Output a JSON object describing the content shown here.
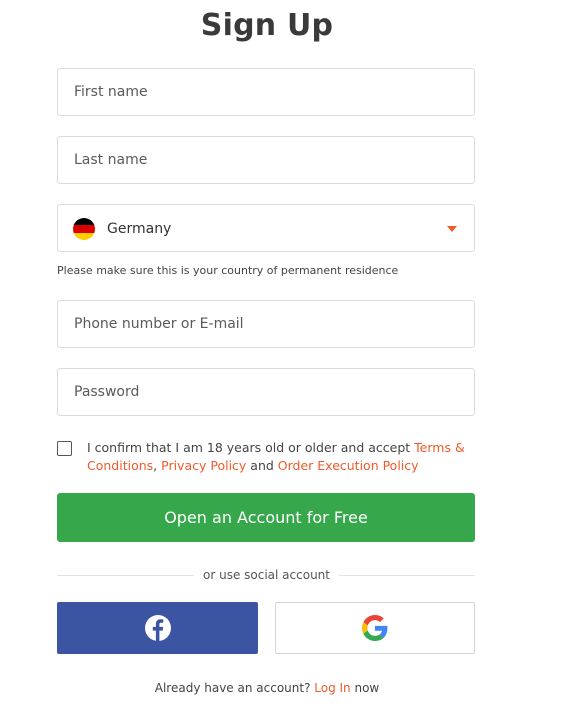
{
  "title": "Sign Up",
  "form": {
    "first_name_placeholder": "First name",
    "last_name_placeholder": "Last name",
    "country": {
      "selected": "Germany",
      "flag_icon": "germany-flag-icon",
      "hint": "Please make sure this is your country of permanent residence"
    },
    "contact_placeholder": "Phone number or E-mail",
    "password_placeholder": "Password",
    "consent": {
      "checked": false,
      "prefix": "I confirm that I am 18 years old or older and accept ",
      "terms_link": "Terms & Conditions",
      "separator": ", ",
      "privacy_link": "Privacy Policy",
      "and": " and ",
      "execution_link": "Order Execution Policy"
    },
    "submit_label": "Open an Account for Free"
  },
  "social": {
    "divider_text": "or use social account",
    "facebook_icon": "facebook-icon",
    "google_icon": "google-icon"
  },
  "footer": {
    "prefix": "Already have an account? ",
    "login_link": "Log In",
    "suffix": " now"
  },
  "colors": {
    "accent": "#f05a28",
    "cta_green": "#36a84b",
    "facebook_blue": "#3b55a3"
  }
}
